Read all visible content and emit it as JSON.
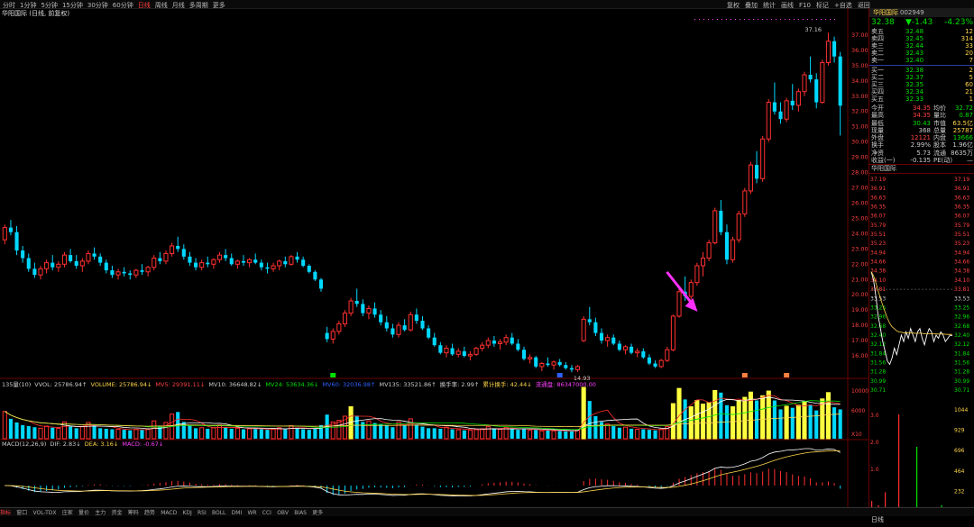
{
  "toolbar": {
    "periods": [
      "分时",
      "1分钟",
      "5分钟",
      "15分钟",
      "30分钟",
      "60分钟",
      "日线",
      "周线",
      "月线",
      "多周期",
      "更多"
    ],
    "active_period": "日线",
    "right_menu": [
      "复权",
      "叠加",
      "统计",
      "画线",
      "F10",
      "标记",
      "+自选",
      "返回"
    ]
  },
  "stock_title": "华阳国际 (日线, 前复权)",
  "quote": {
    "name": "华阳国际",
    "code": "002949",
    "price": "32.38",
    "change": "▼-1.43",
    "pct": "-4.23%",
    "asks": [
      {
        "label": "卖五",
        "price": "32.48",
        "vol": "12"
      },
      {
        "label": "卖四",
        "price": "32.45",
        "vol": "314"
      },
      {
        "label": "卖三",
        "price": "32.44",
        "vol": "33"
      },
      {
        "label": "卖二",
        "price": "32.43",
        "vol": "20"
      },
      {
        "label": "卖一",
        "price": "32.40",
        "vol": "7"
      }
    ],
    "bids": [
      {
        "label": "买一",
        "price": "32.38",
        "vol": "2"
      },
      {
        "label": "买二",
        "price": "32.37",
        "vol": "5"
      },
      {
        "label": "买三",
        "price": "32.35",
        "vol": "60"
      },
      {
        "label": "买四",
        "price": "32.34",
        "vol": "21"
      },
      {
        "label": "买五",
        "price": "32.33",
        "vol": "1"
      }
    ],
    "stats": [
      {
        "l1": "今开",
        "v1": "34.35",
        "c1": "#ff4040",
        "l2": "均价",
        "v2": "32.72",
        "c2": "#00e000"
      },
      {
        "l1": "最高",
        "v1": "34.35",
        "c1": "#ff4040",
        "l2": "量比",
        "v2": "0.87",
        "c2": "#00e000"
      },
      {
        "l1": "最低",
        "v1": "30.43",
        "c1": "#00e000",
        "l2": "市值",
        "v2": "63.5亿",
        "c2": "#ffd54a"
      },
      {
        "l1": "现量",
        "v1": "368",
        "c1": "#ccc",
        "l2": "总量",
        "v2": "25787",
        "c2": "#ffd54a"
      },
      {
        "l1": "外盘",
        "v1": "12121",
        "c1": "#ff4040",
        "l2": "内盘",
        "v2": "13666",
        "c2": "#00e000"
      },
      {
        "l1": "换手",
        "v1": "2.99%",
        "c1": "#ccc",
        "l2": "股本",
        "v2": "1.96亿",
        "c2": "#ccc"
      },
      {
        "l1": "净资",
        "v1": "5.73",
        "c1": "#ccc",
        "l2": "流通",
        "v2": "8635万",
        "c2": "#ccc"
      },
      {
        "l1": "收益(一)",
        "v1": "-0.135",
        "c1": "#ccc",
        "l2": "PE(动)",
        "v2": "—",
        "c2": "#ccc"
      }
    ],
    "sub_name": "华阳国际",
    "intraday_ticks_right": [
      "37.19",
      "36.91",
      "36.63",
      "36.35",
      "36.07",
      "35.79",
      "35.51",
      "35.23",
      "34.94",
      "34.66",
      "34.38",
      "34.10",
      "33.81",
      "33.53",
      "33.25",
      "32.96",
      "32.68",
      "32.40",
      "32.12",
      "31.84",
      "31.56",
      "31.28",
      "30.99",
      "30.71"
    ],
    "intraday_ticks_left": [
      "37.19",
      "36.91",
      "36.63",
      "36.35",
      "36.07",
      "35.79",
      "35.51",
      "35.23",
      "34.94",
      "34.66",
      "34.38",
      "34.10",
      "33.81",
      "33.53",
      "33.25",
      "32.96",
      "32.68",
      "32.40",
      "32.12",
      "31.84",
      "31.56",
      "31.28",
      "30.99",
      "30.71"
    ],
    "vol_ticks": [
      "1044",
      "929",
      "696",
      "464",
      "232",
      "0"
    ],
    "vol_ticks_left": [
      "3.0",
      "2.0",
      "1.0"
    ],
    "bottom_label": "日线"
  },
  "indicators": {
    "vol_line": [
      {
        "text": "135量(10)",
        "color": "#ccc"
      },
      {
        "text": "VVOL: 25786.94↑",
        "color": "#ccc"
      },
      {
        "text": "VOLUME: 25786.94↓",
        "color": "#ffd54a"
      },
      {
        "text": "MV5: 29391.11↓",
        "color": "#ff4040"
      },
      {
        "text": "MV10: 36648.82↓",
        "color": "#ccc"
      },
      {
        "text": "MV24: 53634.36↓",
        "color": "#00e000"
      },
      {
        "text": "MV60: 32036.98↑",
        "color": "#3060ff"
      },
      {
        "text": "MV135: 33521.86↑",
        "color": "#ccc"
      },
      {
        "text": "换手率: 2.99↑",
        "color": "#ccc"
      },
      {
        "text": "累计换手: 42.44↓",
        "color": "#ffd54a"
      },
      {
        "text": "流通盘: 86347000.00",
        "color": "#ff40ff"
      }
    ],
    "macd_line": [
      {
        "text": "MACD(12,26,9)",
        "color": "#ccc"
      },
      {
        "text": "DIF: 2.83↓",
        "color": "#ccc"
      },
      {
        "text": "DEA: 3.16↓",
        "color": "#ffd54a"
      },
      {
        "text": "MACD: -0.67↓",
        "color": "#ff40ff"
      }
    ],
    "vol_ticks": [
      "10000",
      "6000",
      "X10"
    ]
  },
  "chart_data": {
    "type": "candlestick",
    "title": "华阳国际 (日线, 前复权)",
    "price_axis_ticks": [
      "37.00",
      "36.00",
      "35.00",
      "34.00",
      "33.00",
      "32.00",
      "31.00",
      "30.00",
      "29.00",
      "28.00",
      "27.00",
      "26.00",
      "25.00",
      "24.00",
      "23.00",
      "22.00",
      "21.00",
      "20.00",
      "19.00",
      "18.00",
      "17.00",
      "16.00"
    ],
    "ylim": [
      15.0,
      38.0
    ],
    "annotations": [
      {
        "text": "37.16",
        "value": 37.16,
        "kind": "high"
      },
      {
        "text": "14.93",
        "value": 14.93,
        "kind": "low"
      }
    ],
    "candles": [
      [
        23.6,
        24.6,
        23.3,
        24.4
      ],
      [
        24.4,
        24.9,
        23.9,
        24.1
      ],
      [
        24.1,
        24.5,
        22.6,
        22.9
      ],
      [
        22.9,
        23.2,
        22.1,
        22.4
      ],
      [
        22.4,
        22.7,
        21.5,
        21.7
      ],
      [
        21.7,
        22.1,
        21.1,
        21.3
      ],
      [
        21.3,
        21.9,
        21.0,
        21.7
      ],
      [
        21.7,
        22.3,
        21.4,
        22.1
      ],
      [
        22.1,
        22.6,
        21.6,
        21.8
      ],
      [
        21.8,
        22.2,
        21.5,
        22.0
      ],
      [
        22.0,
        22.8,
        21.8,
        22.6
      ],
      [
        22.6,
        23.0,
        22.1,
        22.2
      ],
      [
        22.2,
        22.6,
        21.7,
        21.9
      ],
      [
        21.9,
        22.4,
        21.5,
        22.2
      ],
      [
        22.2,
        22.9,
        22.0,
        22.7
      ],
      [
        22.7,
        23.1,
        22.3,
        22.5
      ],
      [
        22.5,
        22.7,
        21.9,
        22.1
      ],
      [
        22.1,
        22.3,
        21.4,
        21.6
      ],
      [
        21.6,
        21.9,
        21.1,
        21.3
      ],
      [
        21.3,
        21.7,
        21.0,
        21.5
      ],
      [
        21.5,
        21.8,
        21.2,
        21.4
      ],
      [
        21.4,
        21.6,
        21.0,
        21.3
      ],
      [
        21.3,
        21.7,
        21.1,
        21.6
      ],
      [
        21.6,
        22.0,
        21.3,
        21.5
      ],
      [
        21.5,
        21.9,
        21.2,
        21.8
      ],
      [
        21.8,
        22.6,
        21.6,
        22.4
      ],
      [
        22.4,
        22.8,
        22.0,
        22.2
      ],
      [
        22.2,
        22.9,
        22.0,
        22.7
      ],
      [
        22.7,
        23.4,
        22.5,
        23.2
      ],
      [
        23.2,
        23.8,
        22.8,
        23.0
      ],
      [
        23.0,
        23.3,
        22.3,
        22.5
      ],
      [
        22.5,
        22.8,
        21.9,
        22.1
      ],
      [
        22.1,
        22.4,
        21.6,
        21.8
      ],
      [
        21.8,
        22.3,
        21.6,
        22.1
      ],
      [
        22.1,
        22.5,
        21.8,
        22.0
      ],
      [
        22.0,
        22.4,
        21.7,
        22.3
      ],
      [
        22.3,
        22.8,
        22.1,
        22.6
      ],
      [
        22.6,
        23.0,
        22.2,
        22.4
      ],
      [
        22.4,
        22.7,
        21.9,
        22.0
      ],
      [
        22.0,
        22.3,
        21.7,
        22.2
      ],
      [
        22.2,
        22.6,
        21.9,
        22.1
      ],
      [
        22.1,
        22.4,
        21.8,
        22.3
      ],
      [
        22.3,
        22.7,
        22.0,
        22.1
      ],
      [
        22.1,
        22.3,
        21.6,
        21.8
      ],
      [
        21.8,
        22.1,
        21.4,
        21.7
      ],
      [
        21.7,
        22.1,
        21.5,
        21.9
      ],
      [
        21.9,
        22.3,
        21.6,
        22.2
      ],
      [
        22.2,
        22.5,
        21.8,
        22.0
      ],
      [
        22.0,
        22.6,
        21.9,
        22.5
      ],
      [
        22.5,
        22.8,
        22.1,
        22.3
      ],
      [
        22.3,
        22.5,
        21.8,
        21.9
      ],
      [
        21.9,
        22.0,
        21.4,
        21.5
      ],
      [
        21.5,
        21.6,
        20.9,
        21.0
      ],
      [
        21.0,
        21.1,
        20.2,
        20.4
      ],
      [
        17.5,
        17.9,
        16.9,
        17.1
      ],
      [
        17.1,
        17.8,
        16.8,
        17.6
      ],
      [
        17.6,
        18.3,
        17.4,
        18.1
      ],
      [
        18.1,
        19.0,
        17.9,
        18.8
      ],
      [
        18.8,
        19.8,
        18.6,
        19.6
      ],
      [
        19.6,
        20.4,
        19.2,
        19.4
      ],
      [
        19.4,
        19.7,
        18.6,
        18.8
      ],
      [
        18.8,
        19.3,
        18.4,
        19.1
      ],
      [
        19.1,
        19.5,
        18.5,
        18.7
      ],
      [
        18.7,
        19.0,
        18.0,
        18.2
      ],
      [
        18.2,
        18.6,
        17.6,
        17.8
      ],
      [
        17.8,
        18.1,
        17.2,
        17.4
      ],
      [
        17.4,
        18.2,
        17.2,
        18.0
      ],
      [
        18.0,
        18.4,
        17.6,
        17.7
      ],
      [
        17.7,
        18.9,
        17.6,
        18.7
      ],
      [
        18.7,
        19.1,
        18.1,
        18.3
      ],
      [
        18.3,
        18.6,
        17.7,
        17.8
      ],
      [
        17.8,
        18.0,
        17.1,
        17.2
      ],
      [
        17.2,
        17.5,
        16.6,
        16.7
      ],
      [
        16.7,
        16.9,
        16.1,
        16.2
      ],
      [
        16.2,
        16.7,
        15.9,
        16.5
      ],
      [
        16.5,
        16.8,
        16.0,
        16.1
      ],
      [
        16.1,
        16.5,
        15.9,
        16.3
      ],
      [
        16.3,
        16.6,
        15.9,
        16.0
      ],
      [
        16.0,
        16.3,
        15.7,
        16.1
      ],
      [
        16.1,
        16.6,
        16.0,
        16.5
      ],
      [
        16.5,
        16.9,
        16.3,
        16.7
      ],
      [
        16.7,
        17.2,
        16.5,
        17.0
      ],
      [
        17.0,
        17.3,
        16.6,
        16.8
      ],
      [
        16.8,
        17.1,
        16.4,
        16.9
      ],
      [
        16.9,
        17.4,
        16.7,
        17.2
      ],
      [
        17.2,
        17.5,
        16.7,
        16.8
      ],
      [
        16.8,
        17.1,
        16.3,
        16.4
      ],
      [
        16.4,
        16.6,
        15.7,
        15.8
      ],
      [
        15.8,
        16.1,
        15.5,
        15.9
      ],
      [
        15.9,
        16.0,
        15.2,
        15.3
      ],
      [
        15.3,
        15.6,
        15.0,
        15.5
      ],
      [
        15.5,
        15.9,
        15.3,
        15.4
      ],
      [
        15.4,
        15.7,
        15.1,
        15.6
      ],
      [
        15.6,
        15.8,
        15.3,
        15.4
      ],
      [
        15.4,
        15.6,
        15.1,
        15.2
      ],
      [
        15.2,
        15.4,
        14.93,
        15.1
      ],
      [
        15.1,
        15.4,
        14.95,
        15.3
      ],
      [
        17.0,
        18.6,
        16.9,
        18.4
      ],
      [
        18.4,
        19.2,
        18.0,
        18.2
      ],
      [
        18.2,
        18.5,
        17.3,
        17.5
      ],
      [
        17.5,
        17.8,
        16.8,
        17.0
      ],
      [
        17.0,
        17.4,
        16.6,
        17.2
      ],
      [
        17.2,
        17.4,
        16.7,
        16.8
      ],
      [
        16.8,
        17.0,
        16.3,
        16.4
      ],
      [
        16.4,
        16.7,
        16.1,
        16.6
      ],
      [
        16.6,
        16.8,
        16.1,
        16.2
      ],
      [
        16.2,
        16.5,
        15.9,
        16.3
      ],
      [
        16.3,
        16.5,
        15.8,
        15.9
      ],
      [
        15.9,
        16.1,
        15.4,
        15.5
      ],
      [
        15.5,
        15.7,
        15.2,
        15.3
      ],
      [
        15.3,
        15.8,
        15.2,
        15.7
      ],
      [
        15.7,
        16.6,
        15.6,
        16.4
      ],
      [
        16.4,
        18.7,
        16.3,
        18.6
      ],
      [
        18.6,
        20.4,
        18.5,
        20.2
      ],
      [
        20.2,
        21.2,
        19.6,
        19.9
      ],
      [
        19.9,
        21.0,
        19.7,
        20.8
      ],
      [
        20.8,
        22.1,
        20.6,
        21.9
      ],
      [
        21.9,
        22.8,
        21.2,
        22.4
      ],
      [
        22.4,
        23.6,
        22.2,
        23.4
      ],
      [
        23.4,
        25.7,
        23.3,
        25.5
      ],
      [
        25.5,
        26.2,
        23.9,
        24.1
      ],
      [
        24.1,
        24.6,
        22.0,
        22.3
      ],
      [
        22.3,
        23.8,
        22.1,
        23.6
      ],
      [
        23.6,
        25.5,
        23.4,
        25.3
      ],
      [
        25.3,
        27.0,
        25.1,
        26.8
      ],
      [
        26.8,
        28.7,
        26.6,
        28.5
      ],
      [
        28.5,
        29.4,
        27.3,
        27.6
      ],
      [
        27.6,
        30.4,
        27.4,
        30.2
      ],
      [
        30.2,
        32.8,
        30.0,
        32.6
      ],
      [
        32.6,
        33.9,
        31.8,
        32.0
      ],
      [
        32.0,
        32.6,
        31.2,
        31.5
      ],
      [
        31.5,
        32.9,
        31.3,
        32.7
      ],
      [
        32.7,
        33.8,
        32.1,
        32.4
      ],
      [
        32.4,
        33.5,
        32.0,
        33.3
      ],
      [
        33.3,
        34.6,
        33.0,
        34.4
      ],
      [
        34.4,
        35.6,
        33.9,
        34.1
      ],
      [
        34.1,
        34.5,
        32.2,
        32.6
      ],
      [
        32.6,
        35.4,
        32.5,
        35.2
      ],
      [
        35.2,
        37.16,
        35.0,
        36.6
      ],
      [
        36.6,
        36.9,
        35.2,
        35.6
      ],
      [
        35.6,
        35.9,
        30.43,
        32.38
      ]
    ],
    "volume": [
      5200,
      3800,
      3100,
      2600,
      2400,
      2200,
      2000,
      2400,
      2100,
      2000,
      3200,
      2400,
      2000,
      2300,
      3100,
      2600,
      2000,
      1900,
      1800,
      1800,
      1700,
      1600,
      1800,
      1700,
      1900,
      3400,
      2500,
      3100,
      4700,
      5100,
      3200,
      2500,
      2000,
      2100,
      1900,
      2100,
      2600,
      2200,
      1900,
      2000,
      1800,
      1900,
      2000,
      1800,
      1700,
      1800,
      2100,
      1900,
      2500,
      2100,
      1800,
      1700,
      1900,
      2600,
      4600,
      3200,
      3500,
      4300,
      6100,
      4400,
      3200,
      3400,
      3000,
      2800,
      2600,
      2200,
      3200,
      2500,
      3800,
      2700,
      2300,
      2000,
      2000,
      1900,
      2200,
      1800,
      1700,
      1600,
      1600,
      1800,
      1900,
      2300,
      2000,
      1800,
      2200,
      1900,
      1700,
      1800,
      1600,
      1700,
      1500,
      1600,
      1500,
      1500,
      1400,
      1400,
      1600,
      9800,
      7200,
      4300,
      3200,
      2800,
      2400,
      2100,
      2200,
      1900,
      1800,
      1800,
      1700,
      1600,
      1800,
      2300,
      6700,
      9600,
      7500,
      6100,
      7300,
      6600,
      6900,
      9200,
      8800,
      6400,
      6100,
      7300,
      7900,
      8900,
      7300,
      8200,
      9100,
      7300,
      5600,
      6200,
      5900,
      6400,
      7100,
      6500,
      5400,
      7600,
      8800,
      6000,
      5600
    ],
    "macd_ticks": []
  }
}
